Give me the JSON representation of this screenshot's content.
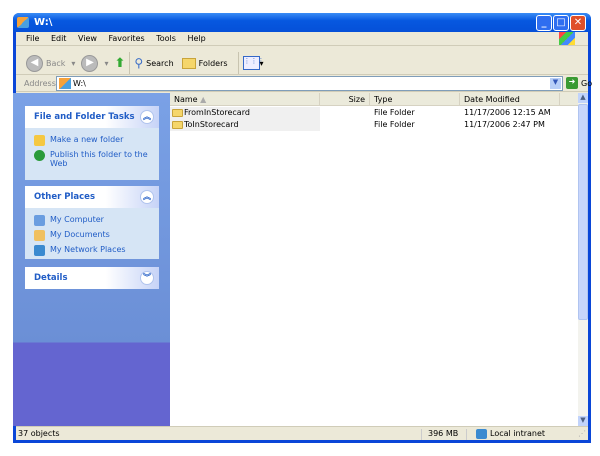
{
  "window": {
    "title": "W:\\"
  },
  "menu": [
    "File",
    "Edit",
    "View",
    "Favorites",
    "Tools",
    "Help"
  ],
  "toolbar": {
    "back": "Back",
    "search": "Search",
    "folders": "Folders"
  },
  "address": {
    "label": "Address",
    "value": "W:\\",
    "go": "Go"
  },
  "sidebar": {
    "file_tasks": {
      "title": "File and Folder Tasks",
      "items": [
        "Make a new folder",
        "Publish this folder to the Web"
      ]
    },
    "other_places": {
      "title": "Other Places",
      "items": [
        "My Computer",
        "My Documents",
        "My Network Places"
      ]
    },
    "details": {
      "title": "Details"
    }
  },
  "list": {
    "columns": [
      "Name",
      "Size",
      "Type",
      "Date Modified"
    ],
    "rows": [
      {
        "name": "FromInStorecard",
        "size": "",
        "type": "File Folder",
        "date": "11/17/2006 12:15 AM"
      },
      {
        "name": "ToInStorecard",
        "size": "",
        "type": "File Folder",
        "date": "11/17/2006 2:47 PM"
      }
    ]
  },
  "status": {
    "objects": "37 objects",
    "size": "396 MB",
    "zone": "Local intranet"
  }
}
